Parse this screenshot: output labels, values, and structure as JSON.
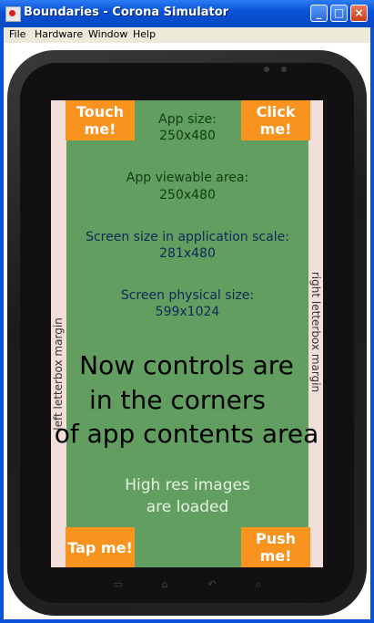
{
  "window": {
    "title": "Boundaries - Corona Simulator"
  },
  "title_buttons": {
    "minimize": "_",
    "maximize": "□",
    "close": "×"
  },
  "menu": [
    "File",
    "Hardware",
    "Window",
    "Help"
  ],
  "margins": {
    "left": "left letterbox margin",
    "right": "right letterbox margin"
  },
  "corners": {
    "top_left": "Touch me!",
    "top_right": "Click me!",
    "bottom_left": "Tap me!",
    "bottom_right": "Push me!"
  },
  "info": {
    "app_size_label": "App size:",
    "app_size_value": "250x480",
    "viewable_label": "App viewable area:",
    "viewable_value": "250x480",
    "screen_scale_label": "Screen size in application scale:",
    "screen_scale_value": "281x480",
    "physical_label": "Screen physical size:",
    "physical_value": "599x1024"
  },
  "message": {
    "line1": "Now controls are",
    "line2": "in the corners",
    "line3": "of app contents area"
  },
  "hires": {
    "line1": "High res images",
    "line2": "are loaded"
  },
  "nav_keys": {
    "menu": "▭",
    "home": "⌂",
    "back": "↶",
    "search": "⌕"
  },
  "colors": {
    "app_bg": "#619e60",
    "corner": "#f7931e",
    "margin": "#f3dfda",
    "titlebar": "#0a52d7"
  }
}
